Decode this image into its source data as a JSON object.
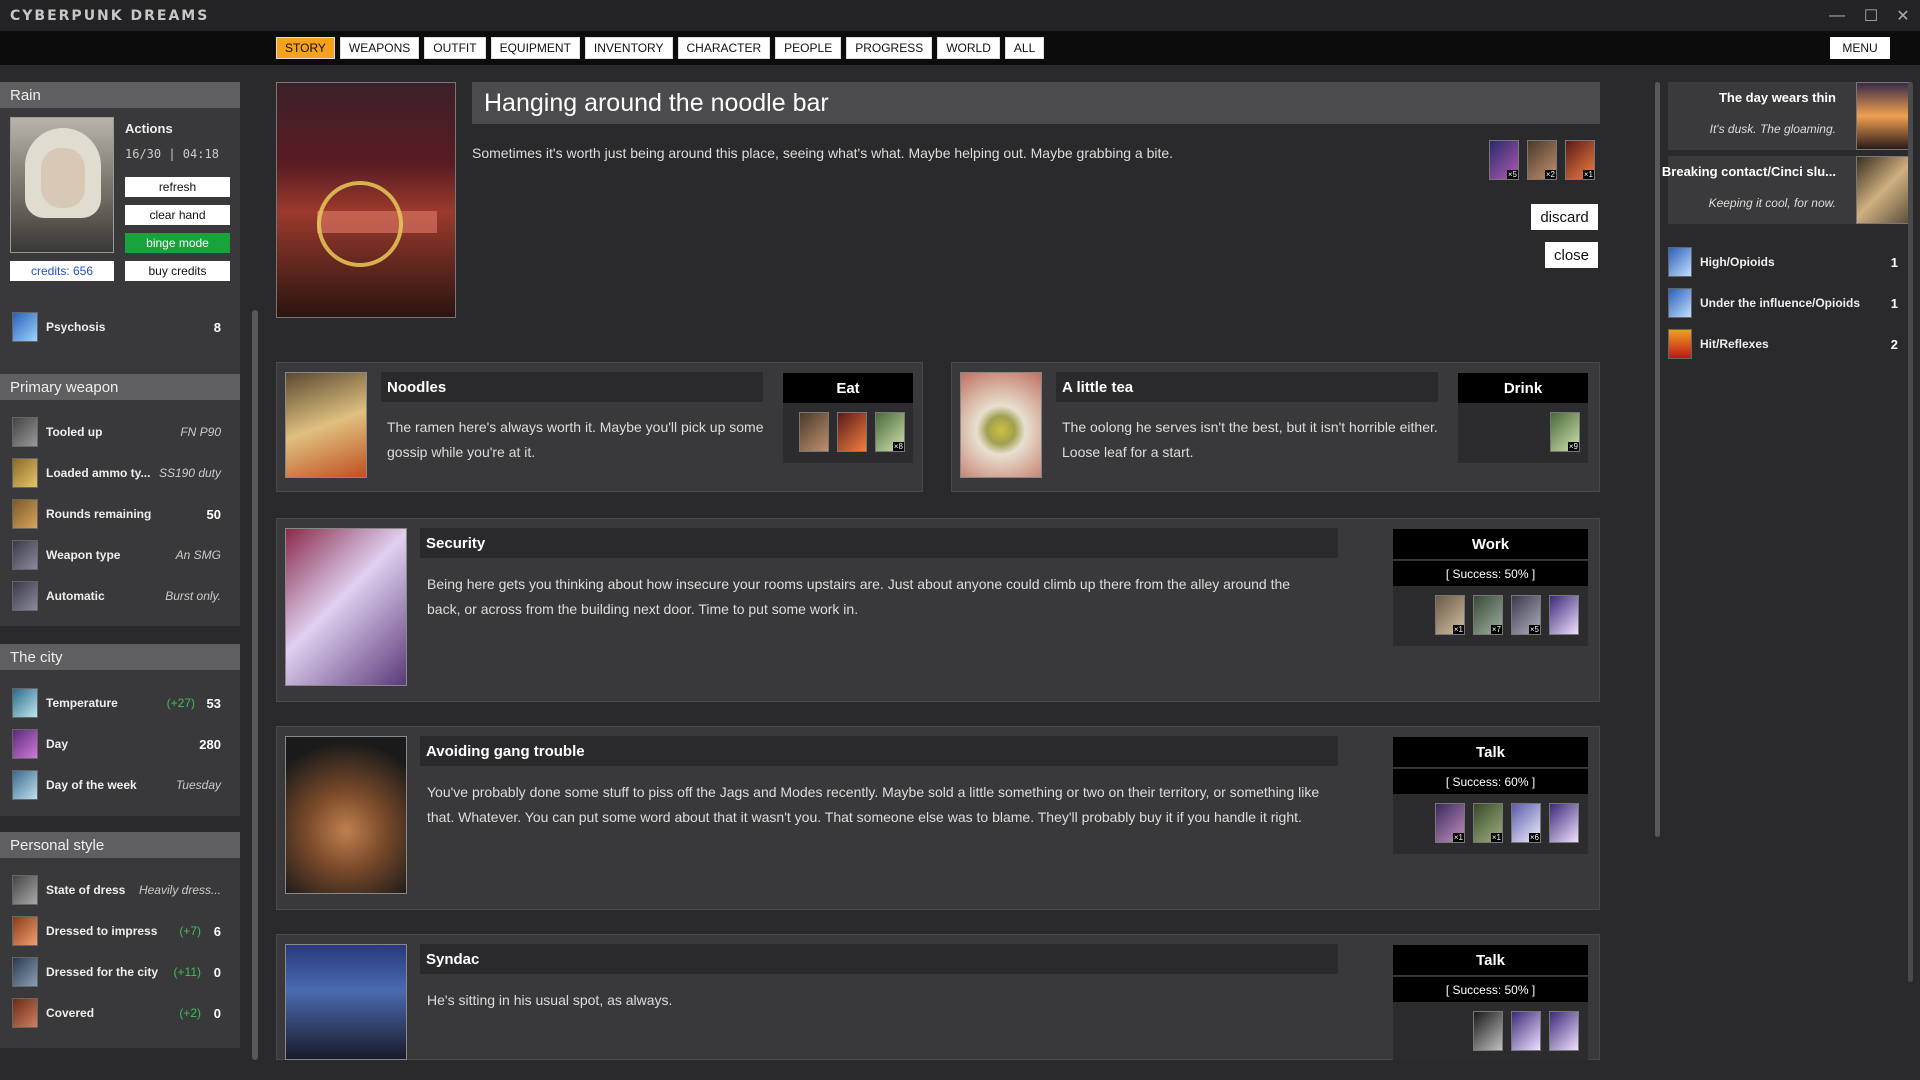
{
  "app": {
    "title": "CYBERPUNK DREAMS"
  },
  "window": {
    "minimize": "—",
    "maximize": "☐",
    "close": "✕"
  },
  "tabs": [
    {
      "label": "STORY",
      "active": true
    },
    {
      "label": "WEAPONS"
    },
    {
      "label": "OUTFIT"
    },
    {
      "label": "EQUIPMENT"
    },
    {
      "label": "INVENTORY"
    },
    {
      "label": "CHARACTER"
    },
    {
      "label": "PEOPLE"
    },
    {
      "label": "PROGRESS"
    },
    {
      "label": "WORLD"
    },
    {
      "label": "ALL"
    }
  ],
  "menu_label": "MENU",
  "character": {
    "name": "Rain",
    "actions_label": "Actions",
    "actions_value": "16/30 | 04:18",
    "refresh": "refresh",
    "clear_hand": "clear hand",
    "binge_mode": "binge mode",
    "credits": "credits: 656",
    "buy_credits": "buy credits",
    "psychosis_label": "Psychosis",
    "psychosis_value": "8"
  },
  "primary_weapon": {
    "heading": "Primary weapon",
    "rows": [
      {
        "label": "Tooled up",
        "value": "FN P90"
      },
      {
        "label": "Loaded ammo ty...",
        "value": "SS190 duty"
      },
      {
        "label": "Rounds remaining",
        "value": "50"
      },
      {
        "label": "Weapon type",
        "value": "An SMG"
      },
      {
        "label": "Automatic",
        "value": "Burst only."
      }
    ]
  },
  "city": {
    "heading": "The city",
    "rows": [
      {
        "label": "Temperature",
        "delta": "(+27)",
        "value": "53"
      },
      {
        "label": "Day",
        "value": "280"
      },
      {
        "label": "Day of the week",
        "value": "Tuesday"
      }
    ]
  },
  "style": {
    "heading": "Personal style",
    "rows": [
      {
        "label": "State of dress",
        "value": "Heavily dress..."
      },
      {
        "label": "Dressed to impress",
        "delta": "(+7)",
        "value": "6"
      },
      {
        "label": "Dressed for the city",
        "delta": "(+11)",
        "value": "0"
      },
      {
        "label": "Covered",
        "delta": "(+2)",
        "value": "0"
      }
    ]
  },
  "location": {
    "title": "Hanging around the noodle bar",
    "description": "Sometimes it's worth just being around this place, seeing what's what. Maybe helping out. Maybe grabbing a bite.",
    "card_badges": [
      "×5",
      "×2",
      "×1"
    ],
    "discard": "discard",
    "close": "close"
  },
  "storylets": [
    {
      "title": "Noodles",
      "verb": "Eat",
      "text": "The ramen here's always worth it. Maybe you'll pick up some gossip while you're at it.",
      "slots": [
        "",
        "",
        "×8"
      ]
    },
    {
      "title": "A little tea",
      "verb": "Drink",
      "text": "The oolong he serves isn't the best, but it isn't horrible either. Loose leaf for a start.",
      "slots": [
        "×9"
      ]
    },
    {
      "title": "Security",
      "verb": "Work",
      "success": "[ Success: 50% ]",
      "text": "Being here gets you thinking about how insecure your rooms upstairs are. Just about anyone could climb up there from the alley around the back, or across from the building next door. Time to put some work in.",
      "slots": [
        "×1",
        "×7",
        "×5",
        ""
      ]
    },
    {
      "title": "Avoiding gang trouble",
      "verb": "Talk",
      "success": "[ Success: 60% ]",
      "text": "You've probably done some stuff to piss off the Jags and Modes recently. Maybe sold a little something or two on their territory, or something like that. Whatever. You can put some word about that it wasn't you. That someone else was to blame. They'll probably buy it if you handle it right.",
      "slots": [
        "×1",
        "×1",
        "×6",
        ""
      ]
    },
    {
      "title": "Syndac",
      "verb": "Talk",
      "success": "[ Success: 50% ]",
      "text": "He's sitting in his usual spot, as always.",
      "slots": [
        "",
        "",
        ""
      ]
    }
  ],
  "events": [
    {
      "title": "The day wears thin",
      "sub": "It's dusk. The gloaming."
    },
    {
      "title": "Breaking contact/Cinci slu...",
      "sub": "Keeping it cool, for now."
    }
  ],
  "statuses": [
    {
      "label": "High/Opioids",
      "value": "1"
    },
    {
      "label": "Under the influence/Opioids",
      "value": "1"
    },
    {
      "label": "Hit/Reflexes",
      "value": "2"
    }
  ]
}
